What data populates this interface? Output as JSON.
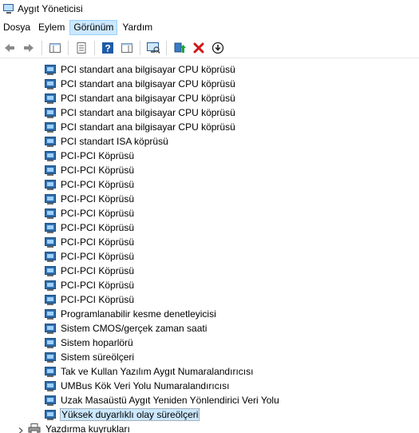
{
  "window": {
    "title": "Aygıt Yöneticisi"
  },
  "menu": [
    {
      "label": "Dosya",
      "active": false
    },
    {
      "label": "Eylem",
      "active": false
    },
    {
      "label": "Görünüm",
      "active": true
    },
    {
      "label": "Yardım",
      "active": false
    }
  ],
  "toolbar": {
    "buttons": [
      {
        "name": "back-button",
        "icon": "arrow-left-icon"
      },
      {
        "name": "forward-button",
        "icon": "arrow-right-icon"
      },
      {
        "name": "show-hide-console-tree-button",
        "icon": "console-tree-icon"
      },
      {
        "name": "properties-button",
        "icon": "properties-icon"
      },
      {
        "name": "help-button",
        "icon": "help-icon"
      },
      {
        "name": "action-pane-button",
        "icon": "action-pane-icon"
      },
      {
        "name": "scan-hardware-button",
        "icon": "monitor-scan-icon"
      },
      {
        "name": "update-driver-button",
        "icon": "update-driver-icon"
      },
      {
        "name": "uninstall-device-button",
        "icon": "red-x-icon"
      },
      {
        "name": "disable-device-button",
        "icon": "down-arrow-circle-icon"
      }
    ]
  },
  "devices": [
    {
      "label": "PCI standart ana bilgisayar CPU köprüsü",
      "selected": false
    },
    {
      "label": "PCI standart ana bilgisayar CPU köprüsü",
      "selected": false
    },
    {
      "label": "PCI standart ana bilgisayar CPU köprüsü",
      "selected": false
    },
    {
      "label": "PCI standart ana bilgisayar CPU köprüsü",
      "selected": false
    },
    {
      "label": "PCI standart ana bilgisayar CPU köprüsü",
      "selected": false
    },
    {
      "label": "PCI standart ISA köprüsü",
      "selected": false
    },
    {
      "label": "PCI-PCI Köprüsü",
      "selected": false
    },
    {
      "label": "PCI-PCI Köprüsü",
      "selected": false
    },
    {
      "label": "PCI-PCI Köprüsü",
      "selected": false
    },
    {
      "label": "PCI-PCI Köprüsü",
      "selected": false
    },
    {
      "label": "PCI-PCI Köprüsü",
      "selected": false
    },
    {
      "label": "PCI-PCI Köprüsü",
      "selected": false
    },
    {
      "label": "PCI-PCI Köprüsü",
      "selected": false
    },
    {
      "label": "PCI-PCI Köprüsü",
      "selected": false
    },
    {
      "label": "PCI-PCI Köprüsü",
      "selected": false
    },
    {
      "label": "PCI-PCI Köprüsü",
      "selected": false
    },
    {
      "label": "PCI-PCI Köprüsü",
      "selected": false
    },
    {
      "label": "Programlanabilir kesme denetleyicisi",
      "selected": false
    },
    {
      "label": "Sistem CMOS/gerçek zaman saati",
      "selected": false
    },
    {
      "label": "Sistem hoparlörü",
      "selected": false
    },
    {
      "label": "Sistem süreölçeri",
      "selected": false
    },
    {
      "label": "Tak ve Kullan Yazılım Aygıt Numaralandırıcısı",
      "selected": false
    },
    {
      "label": "UMBus Kök Veri Yolu Numaralandırıcısı",
      "selected": false
    },
    {
      "label": "Uzak Masaüstü Aygıt Yeniden Yönlendirici Veri Yolu",
      "selected": false
    },
    {
      "label": "Yüksek duyarlıklı olay süreölçeri",
      "selected": true
    }
  ],
  "next_category": {
    "label": "Yazdırma kuyrukları",
    "icon": "printer-icon",
    "expanded": false
  }
}
